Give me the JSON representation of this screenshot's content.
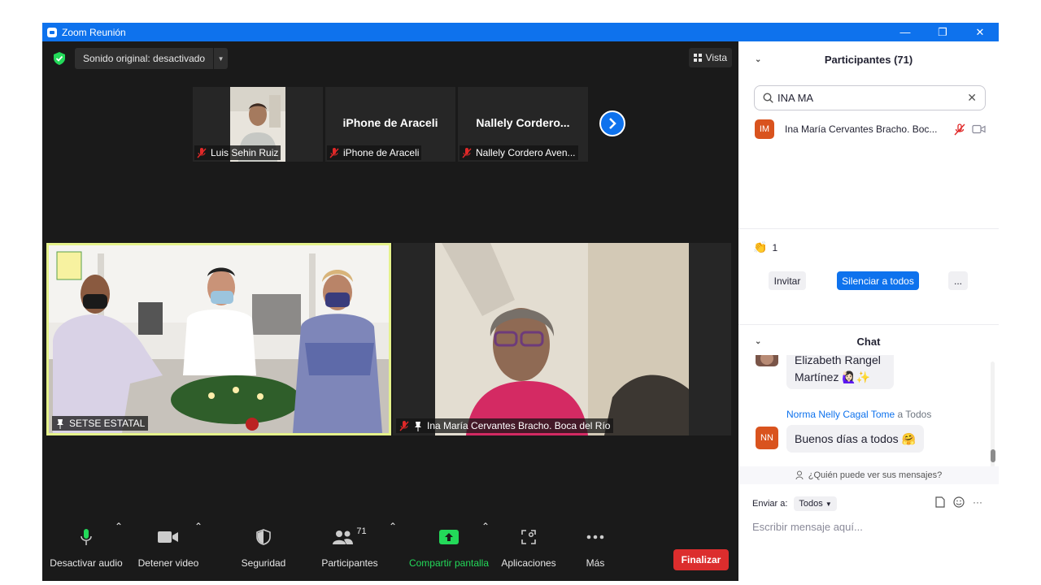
{
  "window": {
    "title": "Zoom Reunión",
    "min": "—",
    "restore": "❐",
    "close": "✕"
  },
  "meeting": {
    "original_sound": "Sonido original: desactivado",
    "view_label": "Vista",
    "thumbnails": [
      {
        "label": "Luis Sehin Ruiz",
        "big_name": ""
      },
      {
        "label": "iPhone de Araceli",
        "big_name": "iPhone de Araceli"
      },
      {
        "label": "Nallely Cordero Aven...",
        "big_name": "Nallely  Cordero..."
      }
    ],
    "tiles": [
      {
        "label": "SETSE ESTATAL"
      },
      {
        "label": "Ina María Cervantes Bracho. Boca del Río"
      }
    ]
  },
  "toolbar": {
    "audio": "Desactivar audio",
    "video": "Detener video",
    "security": "Seguridad",
    "participants": "Participantes",
    "participants_count": "71",
    "share": "Compartir pantalla",
    "apps": "Aplicaciones",
    "more": "Más",
    "end": "Finalizar"
  },
  "participants_panel": {
    "title": "Participantes (71)",
    "search_value": "INA MA",
    "results": [
      {
        "initials": "IM",
        "name": "Ina María Cervantes Bracho. Boc..."
      }
    ],
    "reaction_count": "1",
    "invite": "Invitar",
    "mute_all": "Silenciar a todos",
    "more": "..."
  },
  "chat": {
    "title": "Chat",
    "messages": [
      {
        "text_line1": "Elizabeth Rangel",
        "text_line2": "Martínez 🙋🏻‍♀️✨"
      },
      {
        "sender": "Norma Nelly Cagal Tome",
        "to": "a Todos",
        "initials": "NN",
        "text": "Buenos días a todos 🤗"
      }
    ],
    "who_can_see": "¿Quién puede ver sus mensajes?",
    "send_to_label": "Enviar a:",
    "send_to_value": "Todos",
    "input_placeholder": "Escribir mensaje aquí...",
    "more": "···"
  },
  "colors": {
    "zoom_blue": "#0e72ed",
    "end_red": "#dc2d2d",
    "active_border": "#e5f28b",
    "share_green": "#23d959",
    "avatar_orange": "#d9531e"
  }
}
